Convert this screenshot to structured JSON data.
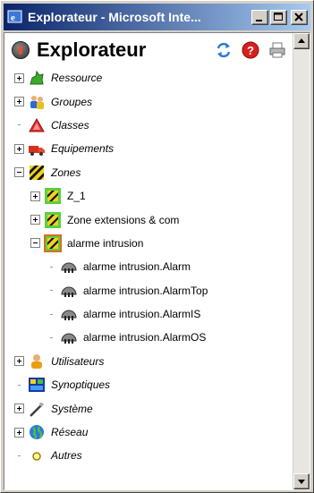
{
  "window": {
    "title": "Explorateur - Microsoft Inte..."
  },
  "panel": {
    "title": "Explorateur",
    "tools": [
      "refresh-icon",
      "help-icon",
      "print-icon"
    ]
  },
  "tree": [
    {
      "label": "Ressource",
      "expander": "plus",
      "icon": "plant-icon",
      "italic": true,
      "level": 0
    },
    {
      "label": "Groupes",
      "expander": "plus",
      "icon": "users-icon",
      "italic": true,
      "level": 0
    },
    {
      "label": "Classes",
      "expander": "none",
      "icon": "triangle-icon",
      "italic": true,
      "level": 0
    },
    {
      "label": "Equipements",
      "expander": "plus",
      "icon": "truck-icon",
      "italic": true,
      "level": 0
    },
    {
      "label": "Zones",
      "expander": "minus",
      "icon": "zone-icon",
      "italic": true,
      "level": 0
    },
    {
      "label": "Z_1",
      "expander": "plus",
      "icon": "zone-green-icon",
      "italic": false,
      "level": 1
    },
    {
      "label": "Zone extensions & com",
      "expander": "plus",
      "icon": "zone-green-icon",
      "italic": false,
      "level": 1
    },
    {
      "label": "alarme intrusion",
      "expander": "minus",
      "icon": "zone-orange-icon",
      "italic": false,
      "level": 1
    },
    {
      "label": "alarme intrusion.Alarm",
      "expander": "none",
      "icon": "sensor-icon",
      "italic": false,
      "level": 2
    },
    {
      "label": "alarme intrusion.AlarmTop",
      "expander": "none",
      "icon": "sensor-icon",
      "italic": false,
      "level": 2
    },
    {
      "label": "alarme intrusion.AlarmIS",
      "expander": "none",
      "icon": "sensor-icon",
      "italic": false,
      "level": 2
    },
    {
      "label": "alarme intrusion.AlarmOS",
      "expander": "none",
      "icon": "sensor-icon",
      "italic": false,
      "level": 2
    },
    {
      "label": "Utilisateurs",
      "expander": "plus",
      "icon": "user-icon",
      "italic": true,
      "level": 0
    },
    {
      "label": "Synoptiques",
      "expander": "none",
      "icon": "synoptic-icon",
      "italic": true,
      "level": 0
    },
    {
      "label": "Système",
      "expander": "plus",
      "icon": "tool-icon",
      "italic": true,
      "level": 0
    },
    {
      "label": "Réseau",
      "expander": "plus",
      "icon": "globe-icon",
      "italic": true,
      "level": 0
    },
    {
      "label": "Autres",
      "expander": "none",
      "icon": "circle-icon",
      "italic": true,
      "level": 0
    }
  ]
}
